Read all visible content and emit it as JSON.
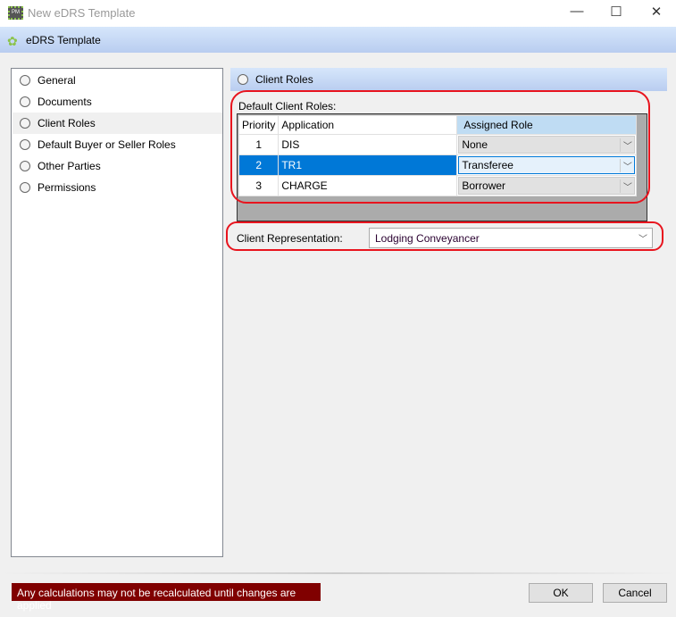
{
  "window": {
    "title": "New eDRS Template",
    "app_icon": "pm-icon",
    "minimize": "—",
    "maximize": "☐",
    "close": "✕"
  },
  "header": {
    "title": "eDRS Template",
    "icon": "gear-flower-icon"
  },
  "sidebar": {
    "items": [
      {
        "label": "General"
      },
      {
        "label": "Documents"
      },
      {
        "label": "Client Roles",
        "selected": true
      },
      {
        "label": "Default Buyer or Seller Roles"
      },
      {
        "label": "Other Parties"
      },
      {
        "label": "Permissions"
      }
    ]
  },
  "section": {
    "title": "Client Roles",
    "default_roles_label": "Default Client Roles:",
    "columns": [
      "Priority",
      "Application",
      "Assigned Role"
    ],
    "rows": [
      {
        "priority": "1",
        "application": "DIS",
        "role": "None"
      },
      {
        "priority": "2",
        "application": "TR1",
        "role": "Transferee",
        "selected": true
      },
      {
        "priority": "3",
        "application": "CHARGE",
        "role": "Borrower"
      }
    ],
    "representation_label": "Client Representation:",
    "representation_value": "Lodging Conveyancer"
  },
  "footer": {
    "message": "Any calculations may not be recalculated until changes are applied",
    "ok": "OK",
    "cancel": "Cancel"
  },
  "colors": {
    "accent": "#0078d7",
    "warning_bg": "#800000",
    "highlight": "#e8141e"
  }
}
